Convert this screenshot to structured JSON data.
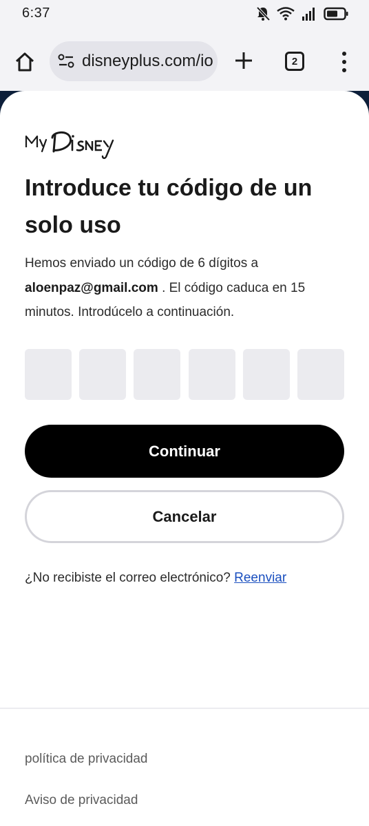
{
  "status_bar": {
    "time": "6:37",
    "icons": [
      "notifications-off-icon",
      "wifi-icon",
      "signal-icon",
      "battery-icon"
    ]
  },
  "browser": {
    "url": "disneyplus.com/io",
    "tab_count": "2"
  },
  "page": {
    "logo_text": "MyDisney",
    "heading": "Introduce tu código de un solo uso",
    "description_before": "Hemos enviado un código de 6 dígitos a ",
    "email": "aloenpaz@gmail.com",
    "description_after": " . El código caduca en 15 minutos. Introdúcelo a continuación.",
    "code_digits": [
      "",
      "",
      "",
      "",
      "",
      ""
    ],
    "continue_label": "Continuar",
    "cancel_label": "Cancelar",
    "resend_prompt": "¿No recibiste el correo electrónico? ",
    "resend_link": "Reenviar"
  },
  "footer": {
    "links": [
      "política de privacidad",
      "Aviso de privacidad"
    ]
  },
  "colors": {
    "primary_button": "#000000",
    "link": "#1a4fbf",
    "code_box": "#ebebef"
  }
}
